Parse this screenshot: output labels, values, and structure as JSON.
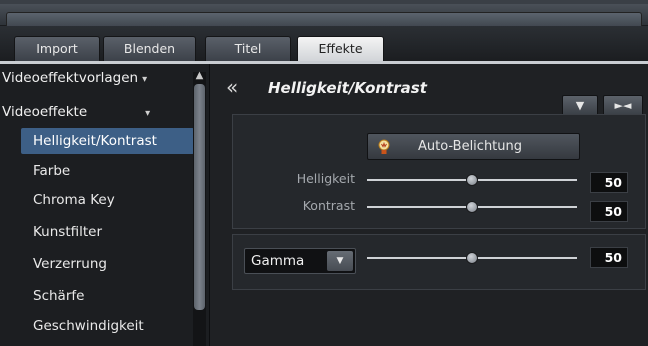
{
  "tabs": [
    {
      "label": "Import"
    },
    {
      "label": "Blenden"
    },
    {
      "label": "Titel"
    },
    {
      "label": "Effekte",
      "active": true
    }
  ],
  "sidebar": {
    "categories": [
      {
        "label": "Videoeffektvorlagen",
        "arrow": "▾"
      },
      {
        "label": "Videoeffekte",
        "arrow": "▾"
      }
    ],
    "items": [
      {
        "label": "Helligkeit/Kontrast",
        "selected": true
      },
      {
        "label": "Farbe"
      },
      {
        "label": "Chroma Key"
      },
      {
        "label": "Kunstfilter"
      },
      {
        "label": "Verzerrung"
      },
      {
        "label": "Schärfe"
      },
      {
        "label": "Geschwindigkeit"
      }
    ],
    "scroll_up_glyph": "▲"
  },
  "panel": {
    "back_glyph": "«",
    "title": "Helligkeit/Kontrast",
    "down_glyph": "▼",
    "reset_glyph": "►◄",
    "auto_button": "Auto-Belichtung",
    "auto_icon": "lightbulb-icon",
    "sliders": [
      {
        "label": "Helligkeit",
        "value": "50",
        "fraction": 0.5
      },
      {
        "label": "Kontrast",
        "value": "50",
        "fraction": 0.5
      }
    ],
    "gamma": {
      "selected": "Gamma",
      "dropdown_glyph": "▼",
      "value": "50",
      "fraction": 0.5
    }
  },
  "colors": {
    "selection": "#3d5f86",
    "active_tab": "#e6e8eb"
  }
}
